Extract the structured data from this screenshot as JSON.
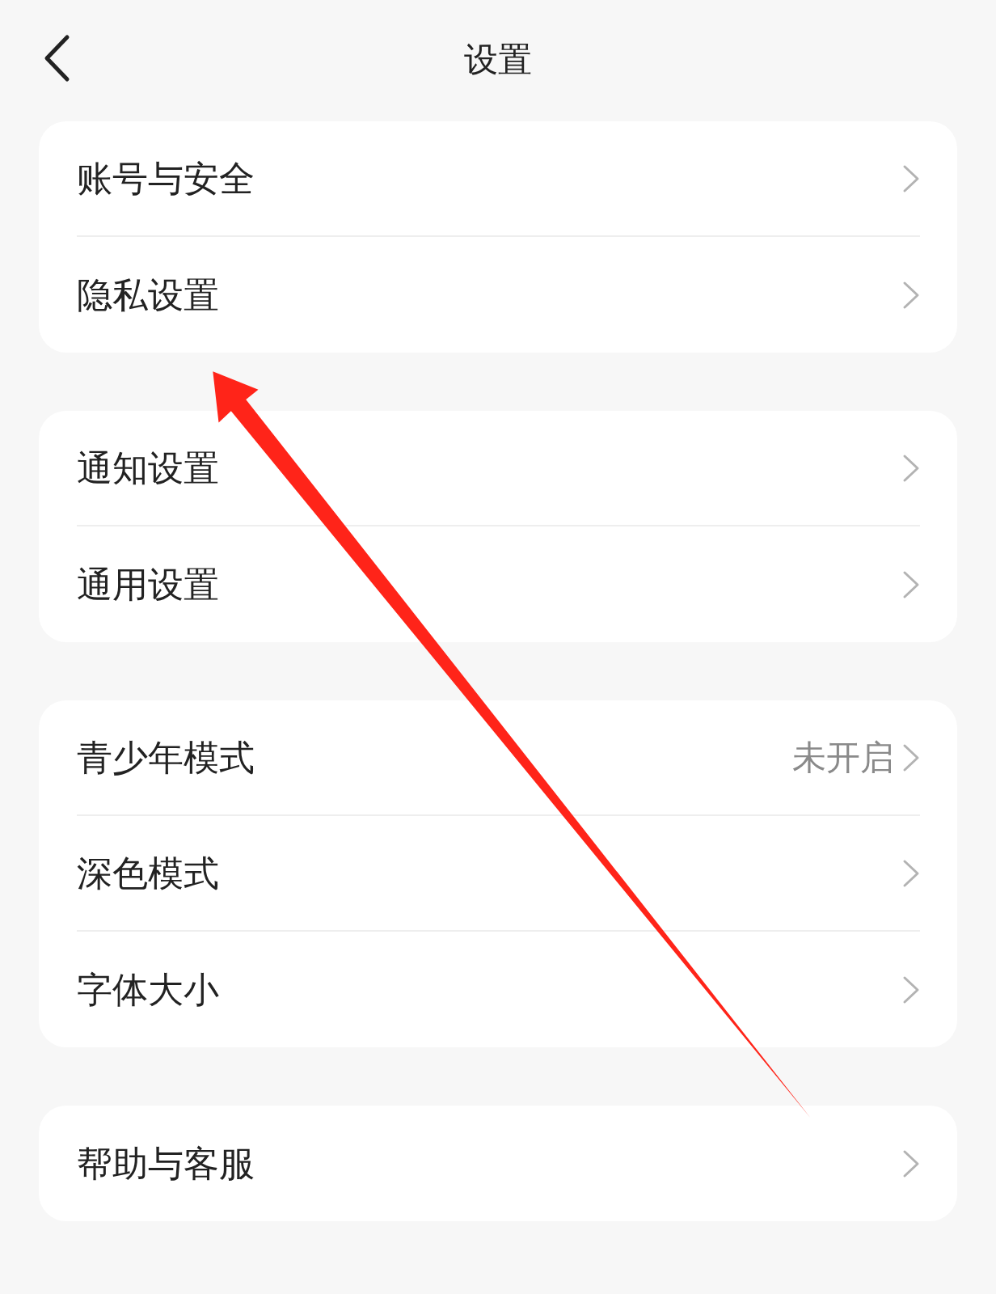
{
  "header": {
    "title": "设置"
  },
  "groups": [
    {
      "items": [
        {
          "label": "账号与安全"
        },
        {
          "label": "隐私设置"
        }
      ]
    },
    {
      "items": [
        {
          "label": "通知设置"
        },
        {
          "label": "通用设置"
        }
      ]
    },
    {
      "items": [
        {
          "label": "青少年模式",
          "value": "未开启"
        },
        {
          "label": "深色模式"
        },
        {
          "label": "字体大小"
        }
      ]
    },
    {
      "items": [
        {
          "label": "帮助与客服"
        }
      ]
    }
  ],
  "annotations": [
    {
      "kind": "arrow",
      "color": "#ff2419"
    }
  ]
}
